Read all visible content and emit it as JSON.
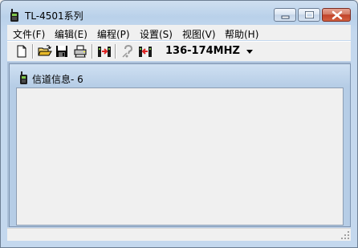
{
  "window": {
    "title": "TL-4501系列"
  },
  "menu": [
    {
      "label": "文件(F)"
    },
    {
      "label": "编辑(E)"
    },
    {
      "label": "编程(P)"
    },
    {
      "label": "设置(S)"
    },
    {
      "label": "视图(V)"
    },
    {
      "label": "帮助(H)"
    }
  ],
  "toolbar": {
    "buttons": [
      {
        "icon": "new-file-icon"
      },
      {
        "icon": "open-folder-icon"
      },
      {
        "icon": "save-icon"
      },
      {
        "icon": "print-icon"
      },
      {
        "icon": "read-from-radio-icon"
      },
      {
        "icon": "help-icon"
      },
      {
        "icon": "write-to-radio-icon"
      }
    ],
    "band_value": "136-174MHZ"
  },
  "child_window": {
    "title": "信道信息- 6"
  },
  "status": {
    "text": ""
  },
  "colors": {
    "titlebar": "#c4d8ee",
    "close_button": "#c2432a",
    "face": "#f0f0f0"
  }
}
